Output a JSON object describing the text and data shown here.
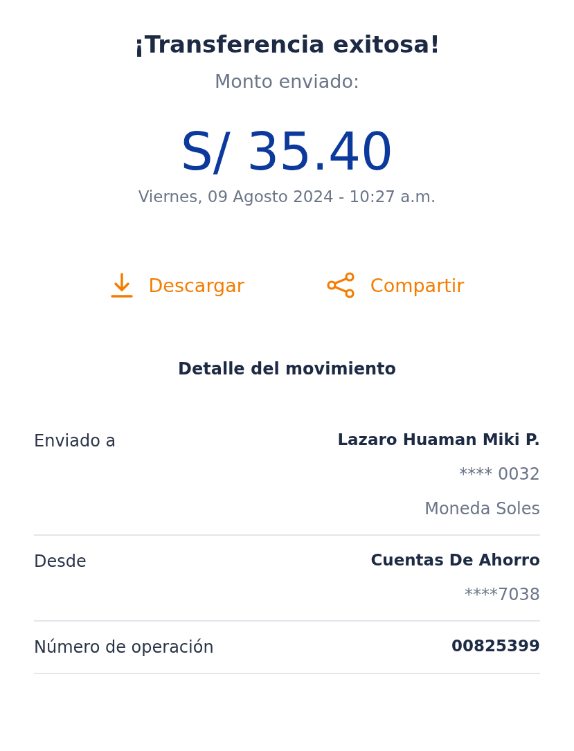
{
  "title": "¡Transferencia exitosa!",
  "subtitle": "Monto enviado:",
  "amount": "S/ 35.40",
  "date": "Viernes, 09 Agosto 2024 - 10:27 a.m.",
  "actions": [
    {
      "kind": "download",
      "label": "Descargar"
    },
    {
      "kind": "share",
      "label": "Compartir"
    }
  ],
  "section_title": "Detalle del movimiento",
  "details": [
    {
      "label": "Enviado a",
      "values": [
        {
          "text": "Lazaro Huaman Miki P.",
          "strong": true
        },
        {
          "text": "**** 0032",
          "strong": false
        },
        {
          "text": "Moneda Soles",
          "strong": false
        }
      ]
    },
    {
      "label": "Desde",
      "values": [
        {
          "text": "Cuentas De Ahorro",
          "strong": true
        },
        {
          "text": "****7038",
          "strong": false
        }
      ]
    },
    {
      "label": "Número de operación",
      "values": [
        {
          "text": "00825399",
          "strong": true
        }
      ]
    }
  ]
}
